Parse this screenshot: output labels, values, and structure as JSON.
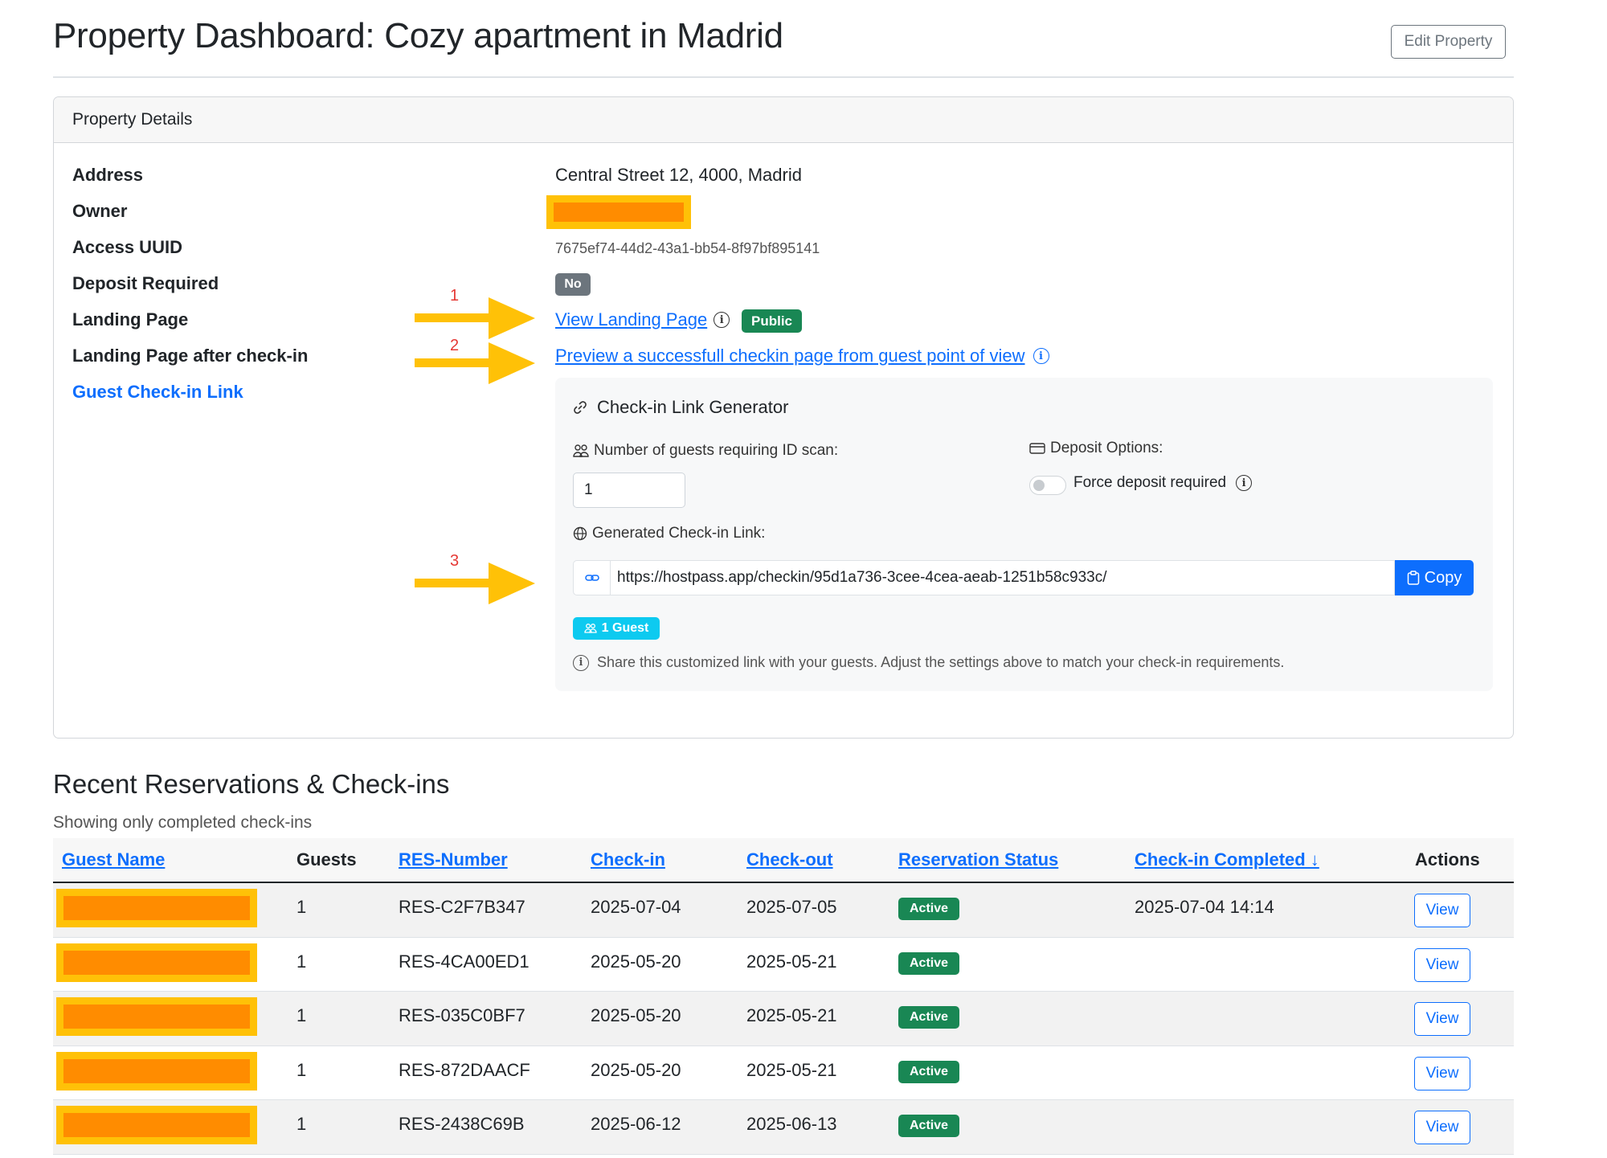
{
  "header": {
    "title": "Property Dashboard: Cozy apartment in Madrid",
    "edit_label": "Edit Property"
  },
  "details": {
    "card_title": "Property Details",
    "address_label": "Address",
    "address_value": "Central Street 12, 4000, Madrid",
    "owner_label": "Owner",
    "uuid_label": "Access UUID",
    "uuid_value": "7675ef74-44d2-43a1-bb54-8f97bf895141",
    "deposit_label": "Deposit Required",
    "deposit_value": "No",
    "landing_label": "Landing Page",
    "landing_link": "View Landing Page",
    "landing_badge": "Public",
    "after_checkin_label": "Landing Page after check-in",
    "after_checkin_link": "Preview a successfull checkin page from guest point of view",
    "guest_link_label": "Guest Check-in Link"
  },
  "annotations": {
    "arrow_1": "1",
    "arrow_2": "2",
    "arrow_3": "3",
    "arrow_color": "#ffc107",
    "number_color": "#e53935"
  },
  "generator": {
    "title": "Check-in Link Generator",
    "guests_label": "Number of guests requiring ID scan:",
    "guests_value": "1",
    "deposit_options_label": "Deposit Options:",
    "force_deposit_label": "Force deposit required",
    "force_deposit_on": false,
    "generated_label": "Generated Check-in Link:",
    "generated_url": "https://hostpass.app/checkin/95d1a736-3cee-4cea-aeab-1251b58c933c/",
    "copy_label": "Copy",
    "guest_badge": "1 Guest",
    "hint": "Share this customized link with your guests. Adjust the settings above to match your check-in requirements."
  },
  "reservations": {
    "title": "Recent Reservations & Check-ins",
    "subtitle": "Showing only completed check-ins",
    "columns": [
      "Guest Name",
      "Guests",
      "RES-Number",
      "Check-in",
      "Check-out",
      "Reservation Status",
      "Check-in Completed ↓",
      "Actions"
    ],
    "rows": [
      {
        "guests": "1",
        "res": "RES-C2F7B347",
        "checkin": "2025-07-04",
        "checkout": "2025-07-05",
        "status": "Active",
        "completed": "2025-07-04 14:14",
        "action": "View"
      },
      {
        "guests": "1",
        "res": "RES-4CA00ED1",
        "checkin": "2025-05-20",
        "checkout": "2025-05-21",
        "status": "Active",
        "completed": "",
        "action": "View"
      },
      {
        "guests": "1",
        "res": "RES-035C0BF7",
        "checkin": "2025-05-20",
        "checkout": "2025-05-21",
        "status": "Active",
        "completed": "",
        "action": "View"
      },
      {
        "guests": "1",
        "res": "RES-872DAACF",
        "checkin": "2025-05-20",
        "checkout": "2025-05-21",
        "status": "Active",
        "completed": "",
        "action": "View"
      },
      {
        "guests": "1",
        "res": "RES-2438C69B",
        "checkin": "2025-06-12",
        "checkout": "2025-06-13",
        "status": "Active",
        "completed": "",
        "action": "View"
      }
    ]
  },
  "colors": {
    "primary": "#0d6efd",
    "success": "#198754",
    "info": "#0dcaf0",
    "secondary": "#6c757d",
    "redaction": "#ff8c00",
    "redaction_border": "#ffc107"
  }
}
